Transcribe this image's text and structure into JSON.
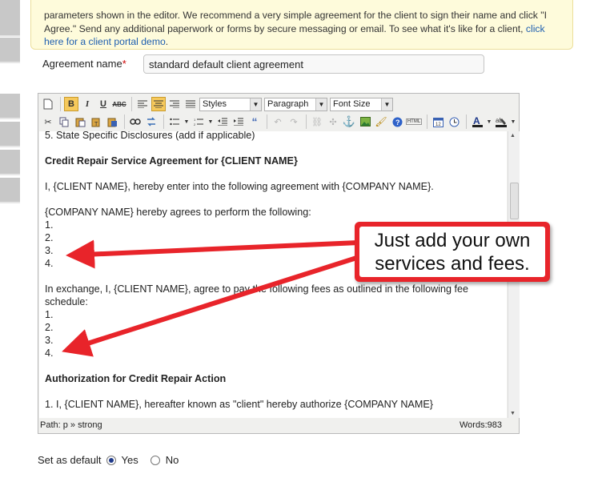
{
  "notice": {
    "line1_partial": "parameters shown in the editor. We recommend a very simple agreement for the client to sign their name and click \"I",
    "line2": "Agree.\" Send any additional paperwork or forms by secure messaging or email. To see what it's like for a client,",
    "link_part1": "click",
    "link_part2": "here for a client portal demo",
    "after_link": "."
  },
  "agreement": {
    "label": "Agreement name",
    "required_mark": "*",
    "value": "standard default client agreement"
  },
  "toolbar": {
    "styles": "Styles",
    "paragraph": "Paragraph",
    "font_size": "Font Size"
  },
  "editor_content": {
    "line_disclosures": "5. State Specific Disclosures (add if applicable)",
    "heading_service": "Credit Repair Service Agreement for {CLIENT NAME}",
    "intro": "I, {CLIENT NAME}, hereby enter into the following agreement with {COMPANY NAME}.",
    "agrees": "{COMPANY NAME} hereby agrees to perform the following:",
    "list1": [
      "1.",
      "2.",
      "3.",
      "4."
    ],
    "exchange": "In exchange, I, {CLIENT NAME}, agree to pay the following fees as outlined in the following fee schedule:",
    "list2": [
      "1.",
      "2.",
      "3.",
      "4."
    ],
    "heading_auth": "Authorization for Credit Repair Action",
    "auth_partial": "1. I, {CLIENT NAME}, hereafter known as \"client\" hereby authorize {COMPANY NAME}"
  },
  "status": {
    "path": "Path: p » strong",
    "words": "Words:983"
  },
  "default_setting": {
    "label": "Set as default",
    "yes": "Yes",
    "no": "No",
    "selected": "Yes"
  },
  "callout": {
    "line1": "Just add your own",
    "line2": "services and fees."
  },
  "colors": {
    "callout_red": "#e8242a",
    "notice_bg": "#fefbdb",
    "link": "#1f5fb0"
  }
}
